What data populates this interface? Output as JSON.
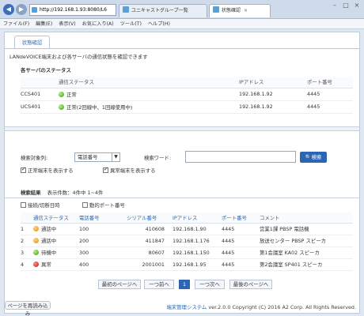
{
  "browser": {
    "url": "http://192.168.1.93:8080/L6",
    "tabs": [
      {
        "label": "ユニキャストグループ一覧"
      },
      {
        "label": "状態確認"
      }
    ],
    "menu": [
      "ファイル(F)",
      "編集(E)",
      "表示(V)",
      "お気に入り(A)",
      "ツール(T)",
      "ヘルプ(H)"
    ]
  },
  "page": {
    "tab_label": "状態確認",
    "description": "LANdeVOICE端末および各サーバの通信状態を確認できます"
  },
  "servers": {
    "title": "各サーバのステータス",
    "columns": [
      "通信ステータス",
      "IPアドレス",
      "ポート番号"
    ],
    "rows": [
      {
        "name": "CCS401",
        "status": "正常",
        "ip": "192.168.1.92",
        "port": "4445",
        "color": "green"
      },
      {
        "name": "UCS401",
        "status": "正常(2回線中、1回線使用中)",
        "ip": "192.168.1.92",
        "port": "4445",
        "color": "green"
      }
    ]
  },
  "search": {
    "condition_label": "検索対象列:",
    "condition_value": "電話番号",
    "keyword_label": "検索ワード:",
    "keyword_value": "",
    "button": "検索",
    "normal_check": "正常端末を表示する",
    "abnormal_check": "異常端末を表示する"
  },
  "results": {
    "title": "検索結果",
    "count_text": "表示件数：4件中 1~4件",
    "opt_connect_time": "接続/切断日時",
    "opt_dynamic_port": "動的ポート番号",
    "columns": [
      "通信ステータス",
      "電話番号",
      "シリアル番号",
      "IPアドレス",
      "ポート番号",
      "コメント"
    ],
    "rows": [
      {
        "no": "1",
        "status": "通話中",
        "phone": "100",
        "serial": "410608",
        "ip": "192.168.1.90",
        "port": "4445",
        "comment": "営業1課  PBSP  電話機",
        "color": "orange"
      },
      {
        "no": "2",
        "status": "通話中",
        "phone": "200",
        "serial": "411847",
        "ip": "192.168.1.176",
        "port": "4445",
        "comment": "放送センター  PBSP  スピーカ",
        "color": "orange"
      },
      {
        "no": "3",
        "status": "待機中",
        "phone": "300",
        "serial": "80607",
        "ip": "192.168.1.150",
        "port": "4445",
        "comment": "第1会議室  KA02  スピーカ",
        "color": "green"
      },
      {
        "no": "4",
        "status": "異常",
        "phone": "400",
        "serial": "2001001",
        "ip": "192.168.1.95",
        "port": "4445",
        "comment": "第2会議室  SP401  スピーカ",
        "color": "red"
      }
    ]
  },
  "pager": {
    "first": "最初のページへ",
    "prev": "一つ前へ",
    "current": "1",
    "next": "一つ次へ",
    "last": "最後のページへ"
  },
  "footer": {
    "reload": "ページを再読み込み",
    "system": "端末管理システム",
    "copyright": "ver.2.0.0 Copyright (C) 2016 A2 Corp. All Rights Reserved."
  }
}
